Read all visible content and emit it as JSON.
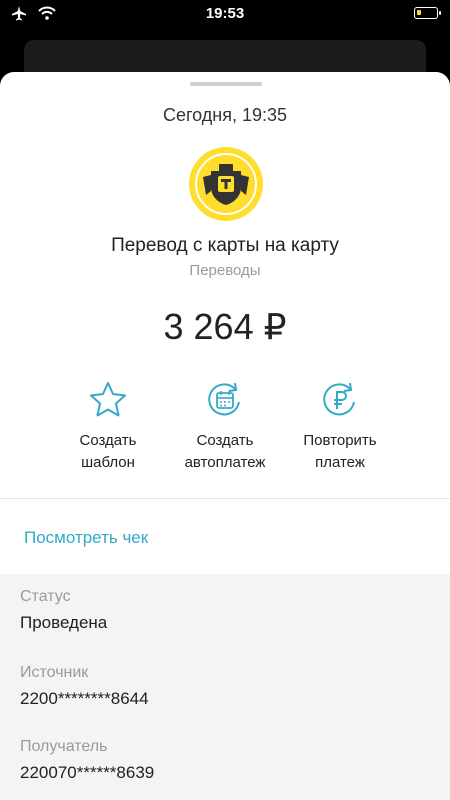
{
  "statusbar": {
    "time": "19:53",
    "icons": [
      "airplane-icon",
      "wifi-icon",
      "battery-icon"
    ]
  },
  "operation": {
    "date": "Сегодня, 19:35",
    "logo": "tinkoff-logo",
    "title": "Перевод с карты на карту",
    "category": "Переводы",
    "amount": "3 264 ₽"
  },
  "actions": [
    {
      "label_line1": "Создать",
      "label_line2": "шаблон",
      "icon": "star-icon"
    },
    {
      "label_line1": "Создать",
      "label_line2": "автоплатеж",
      "icon": "calendar-repeat-icon"
    },
    {
      "label_line1": "Повторить",
      "label_line2": "платеж",
      "icon": "ruble-repeat-icon"
    }
  ],
  "receipt_link": "Посмотреть чек",
  "details": {
    "status_label": "Статус",
    "status_value": "Проведена",
    "source_label": "Источник",
    "source_value": "2200********8644",
    "recipient_label": "Получатель",
    "recipient_value": "220070******8639"
  },
  "colors": {
    "accent": "#33a9c7",
    "brand_yellow": "#ffdd2d",
    "details_bg": "#f3f4f5"
  }
}
